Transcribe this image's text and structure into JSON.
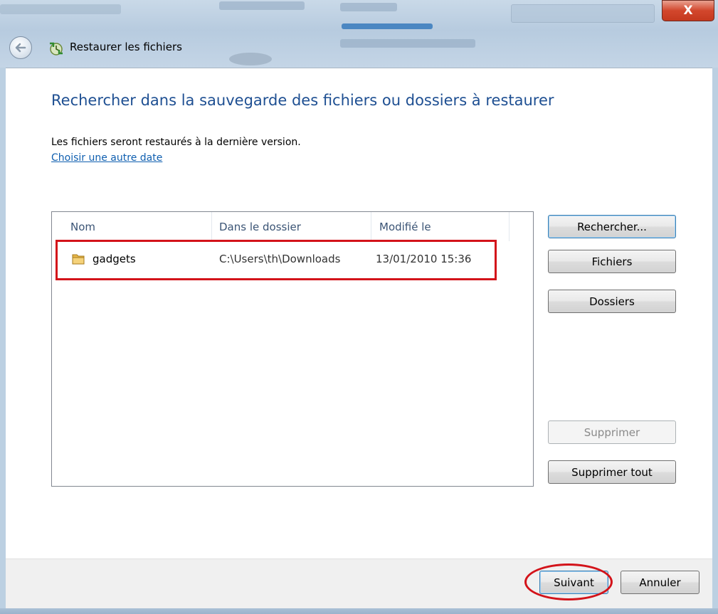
{
  "window": {
    "title": "Restaurer les fichiers",
    "close_glyph": "X",
    "icons": {
      "close": "close-icon",
      "back": "back-arrow-icon",
      "app": "restore-files-icon"
    }
  },
  "main": {
    "heading": "Rechercher dans la sauvegarde des fichiers ou dossiers à restaurer",
    "info": "Les fichiers seront restaurés à la dernière version.",
    "date_link": "Choisir une autre date"
  },
  "file_list": {
    "columns": [
      "Nom",
      "Dans le dossier",
      "Modifié le"
    ],
    "rows": [
      {
        "name": "gadgets",
        "folder": "C:\\Users\\th\\Downloads",
        "modified": "13/01/2010 15:36",
        "icon": "folder-icon"
      }
    ]
  },
  "side_buttons": {
    "search": "Rechercher...",
    "files": "Fichiers",
    "folders": "Dossiers",
    "remove": "Supprimer",
    "remove_all": "Supprimer tout"
  },
  "footer": {
    "next": "Suivant",
    "cancel": "Annuler"
  },
  "colors": {
    "heading": "#1e4f92",
    "link": "#0f5fb0",
    "annotation_red": "#d3131a"
  }
}
